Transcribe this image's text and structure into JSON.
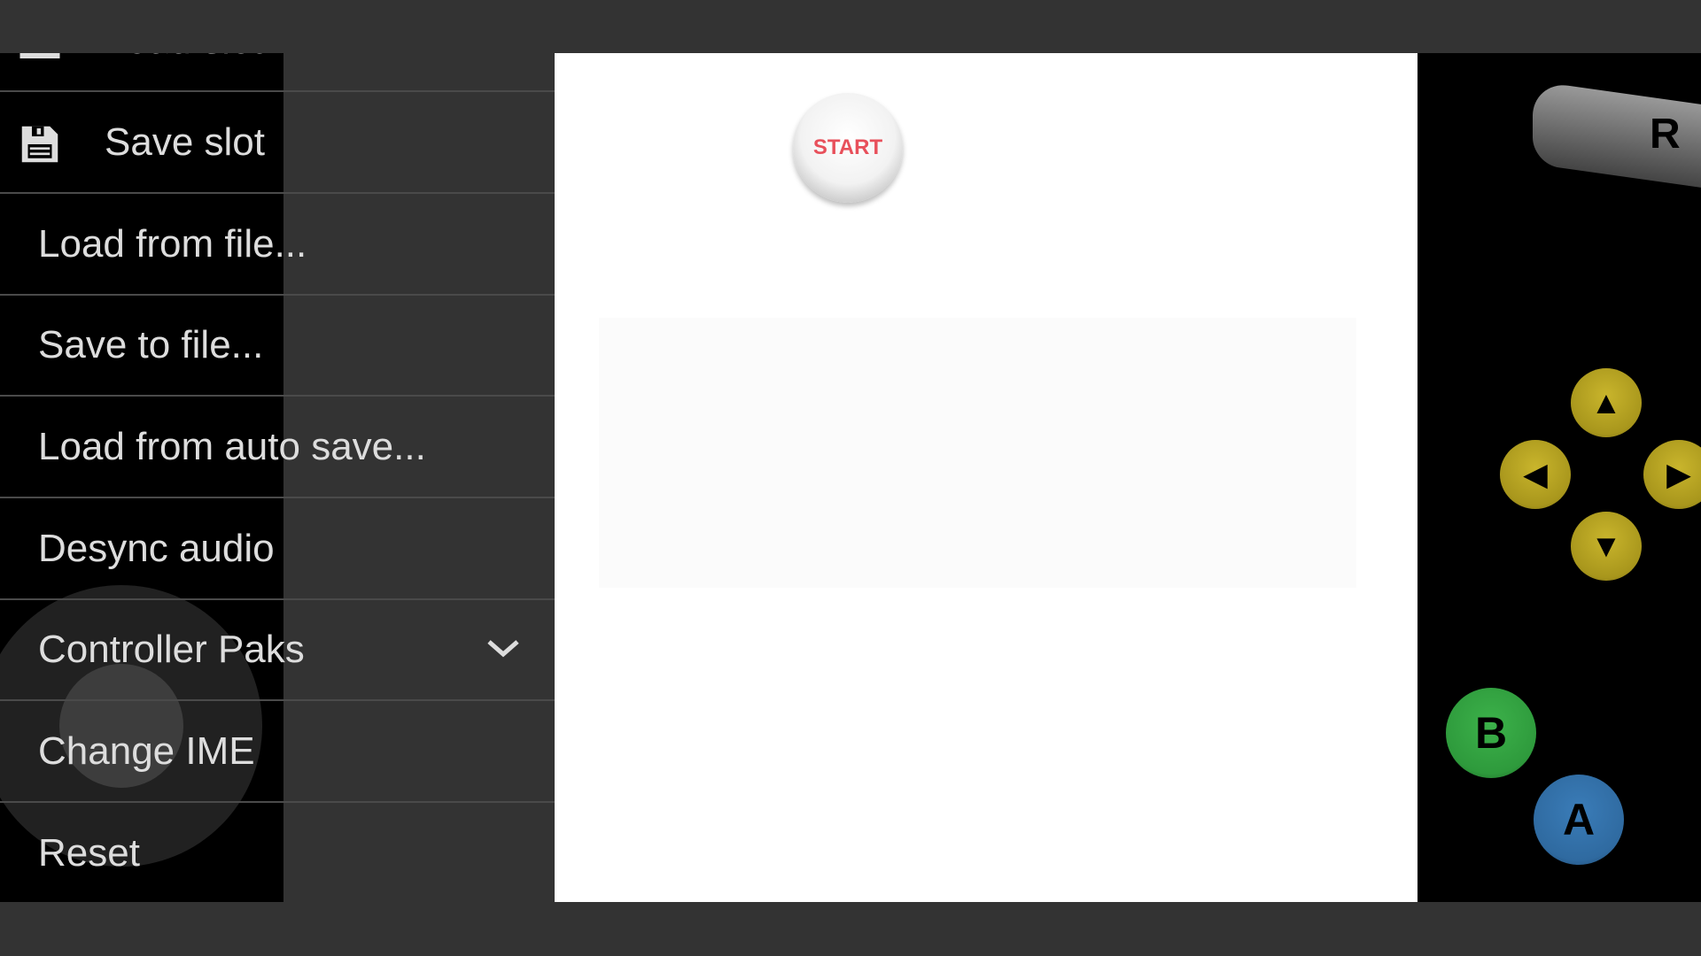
{
  "menu": {
    "items": [
      {
        "label": "Load slot",
        "icon": "folder-icon"
      },
      {
        "label": "Save slot",
        "icon": "floppy-disk-icon"
      },
      {
        "label": "Load from file..."
      },
      {
        "label": "Save to file..."
      },
      {
        "label": "Load from auto save..."
      },
      {
        "label": "Desync audio"
      },
      {
        "label": "Controller Paks",
        "icon": "chevron-down-icon"
      },
      {
        "label": "Change IME"
      },
      {
        "label": "Reset"
      }
    ]
  },
  "controls": {
    "start": "START",
    "r": "R",
    "b": "B",
    "a": "A",
    "b_color": "#2e9a3c",
    "a_color": "#2f6aa0",
    "c_color": "#b8a424"
  }
}
